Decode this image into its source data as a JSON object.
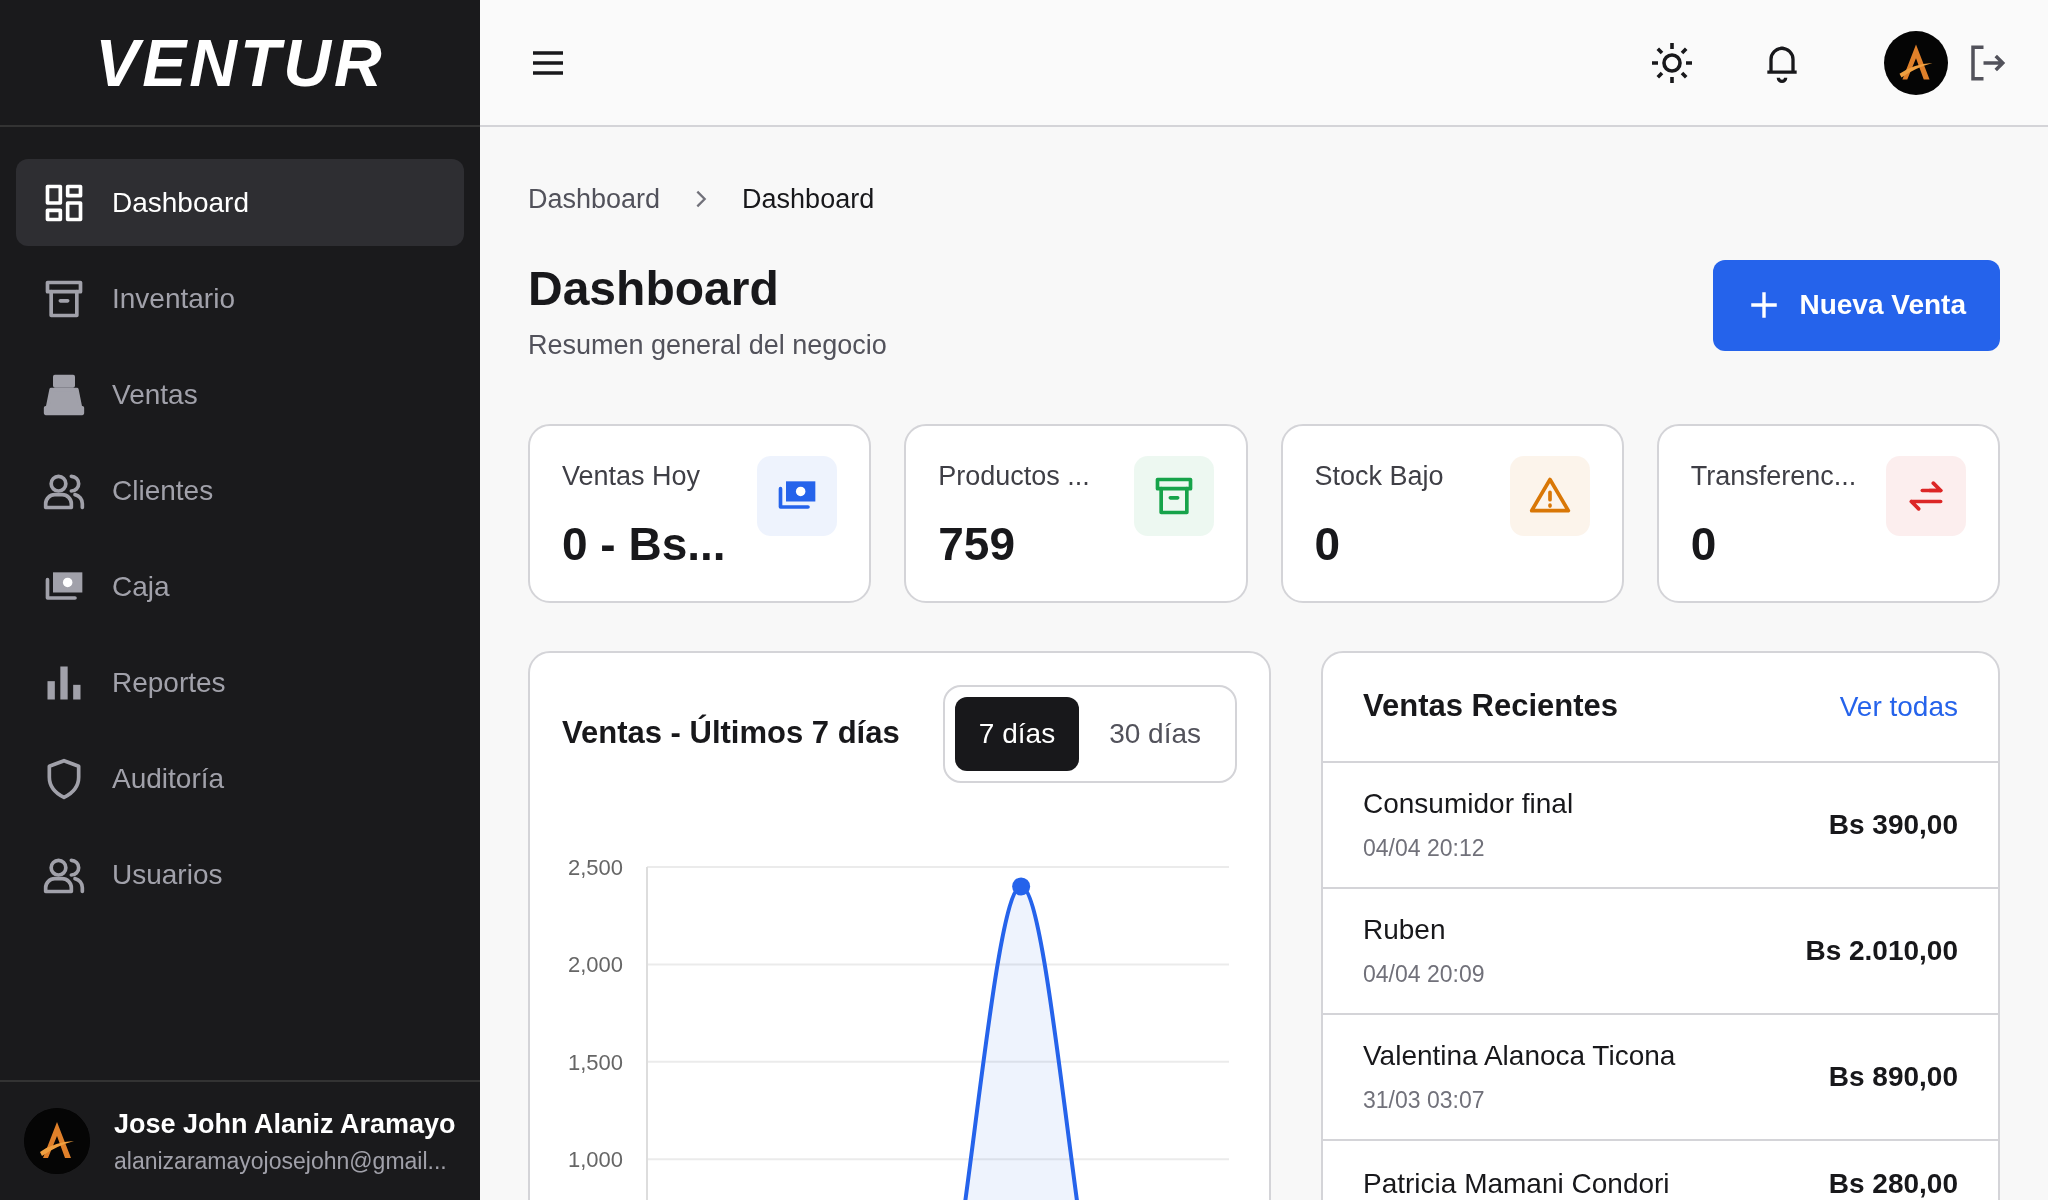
{
  "sidebar": {
    "logo": "VENTUR",
    "items": [
      {
        "label": "Dashboard",
        "selected": true
      },
      {
        "label": "Inventario",
        "selected": false
      },
      {
        "label": "Ventas",
        "selected": false
      },
      {
        "label": "Clientes",
        "selected": false
      },
      {
        "label": "Caja",
        "selected": false
      },
      {
        "label": "Reportes",
        "selected": false
      },
      {
        "label": "Auditoría",
        "selected": false
      },
      {
        "label": "Usuarios",
        "selected": false
      }
    ],
    "user": {
      "name": "Jose John Alaniz Aramayo",
      "email": "alanizaramayojosejohn@gmail..."
    }
  },
  "breadcrumb": [
    "Dashboard",
    "Dashboard"
  ],
  "header": {
    "title": "Dashboard",
    "subtitle": "Resumen general del negocio",
    "button": "Nueva Venta"
  },
  "stats": [
    {
      "label": "Ventas Hoy",
      "value": "0 - Bs...",
      "color": "#2563eb"
    },
    {
      "label": "Productos ...",
      "value": "759",
      "color": "#16a34a"
    },
    {
      "label": "Stock Bajo",
      "value": "0",
      "color": "#d97706"
    },
    {
      "label": "Transferenc...",
      "value": "0",
      "color": "#dc2626"
    }
  ],
  "chart_card": {
    "title": "Ventas - Últimos 7 días",
    "ranges": [
      {
        "label": "7 días",
        "selected": true
      },
      {
        "label": "30 días",
        "selected": false
      }
    ],
    "chart_data": {
      "type": "area",
      "grid": true,
      "ylim": [
        0,
        2500
      ],
      "yticks": [
        {
          "value": 1000,
          "label": "1,000"
        },
        {
          "value": 1500,
          "label": "1,500"
        },
        {
          "value": 2000,
          "label": "2,000"
        },
        {
          "value": 2500,
          "label": "2,500"
        }
      ],
      "series": [
        {
          "color": "#2563eb",
          "values": [
            0,
            0,
            0,
            0,
            2400,
            0,
            0
          ]
        }
      ]
    }
  },
  "recent": {
    "title": "Ventas Recientes",
    "link": "Ver todas",
    "rows": [
      {
        "customer": "Consumidor final",
        "date": "04/04 20:12",
        "amount": "Bs 390,00"
      },
      {
        "customer": "Ruben",
        "date": "04/04 20:09",
        "amount": "Bs 2.010,00"
      },
      {
        "customer": "Valentina Alanoca Ticona",
        "date": "31/03 03:07",
        "amount": "Bs 890,00"
      },
      {
        "customer": "Patricia Mamani Condori",
        "date": "",
        "amount": "Bs 280,00"
      }
    ]
  }
}
